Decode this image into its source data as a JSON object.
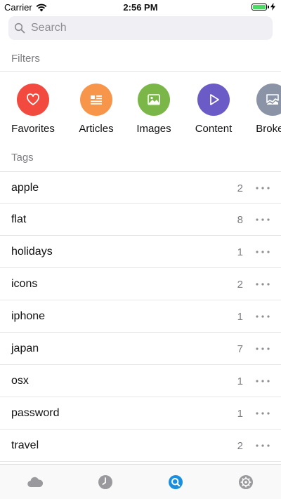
{
  "status_bar": {
    "carrier": "Carrier",
    "time": "2:56 PM",
    "battery_level": 1.0
  },
  "search": {
    "placeholder": "Search",
    "value": ""
  },
  "filters": {
    "title": "Filters",
    "items": [
      {
        "label": "Favorites",
        "icon": "heart-icon",
        "color": "#f24a3e"
      },
      {
        "label": "Articles",
        "icon": "article-icon",
        "color": "#f7964a"
      },
      {
        "label": "Images",
        "icon": "image-icon",
        "color": "#7ab648"
      },
      {
        "label": "Content",
        "icon": "play-icon",
        "color": "#6a5bc7"
      },
      {
        "label": "Broken",
        "icon": "broken-image-icon",
        "color": "#8a94a6"
      }
    ]
  },
  "tags": {
    "title": "Tags",
    "items": [
      {
        "name": "apple",
        "count": "2"
      },
      {
        "name": "flat",
        "count": "8"
      },
      {
        "name": "holidays",
        "count": "1"
      },
      {
        "name": "icons",
        "count": "2"
      },
      {
        "name": "iphone",
        "count": "1"
      },
      {
        "name": "japan",
        "count": "7"
      },
      {
        "name": "osx",
        "count": "1"
      },
      {
        "name": "password",
        "count": "1"
      },
      {
        "name": "travel",
        "count": "2"
      }
    ]
  },
  "tab_bar": {
    "tabs": [
      {
        "icon": "cloud-icon",
        "selected": false
      },
      {
        "icon": "clock-icon",
        "selected": false
      },
      {
        "icon": "search-icon",
        "selected": true
      },
      {
        "icon": "gear-icon",
        "selected": false
      }
    ],
    "active_color": "#1a8fe0",
    "inactive_color": "#9a9a9e"
  }
}
